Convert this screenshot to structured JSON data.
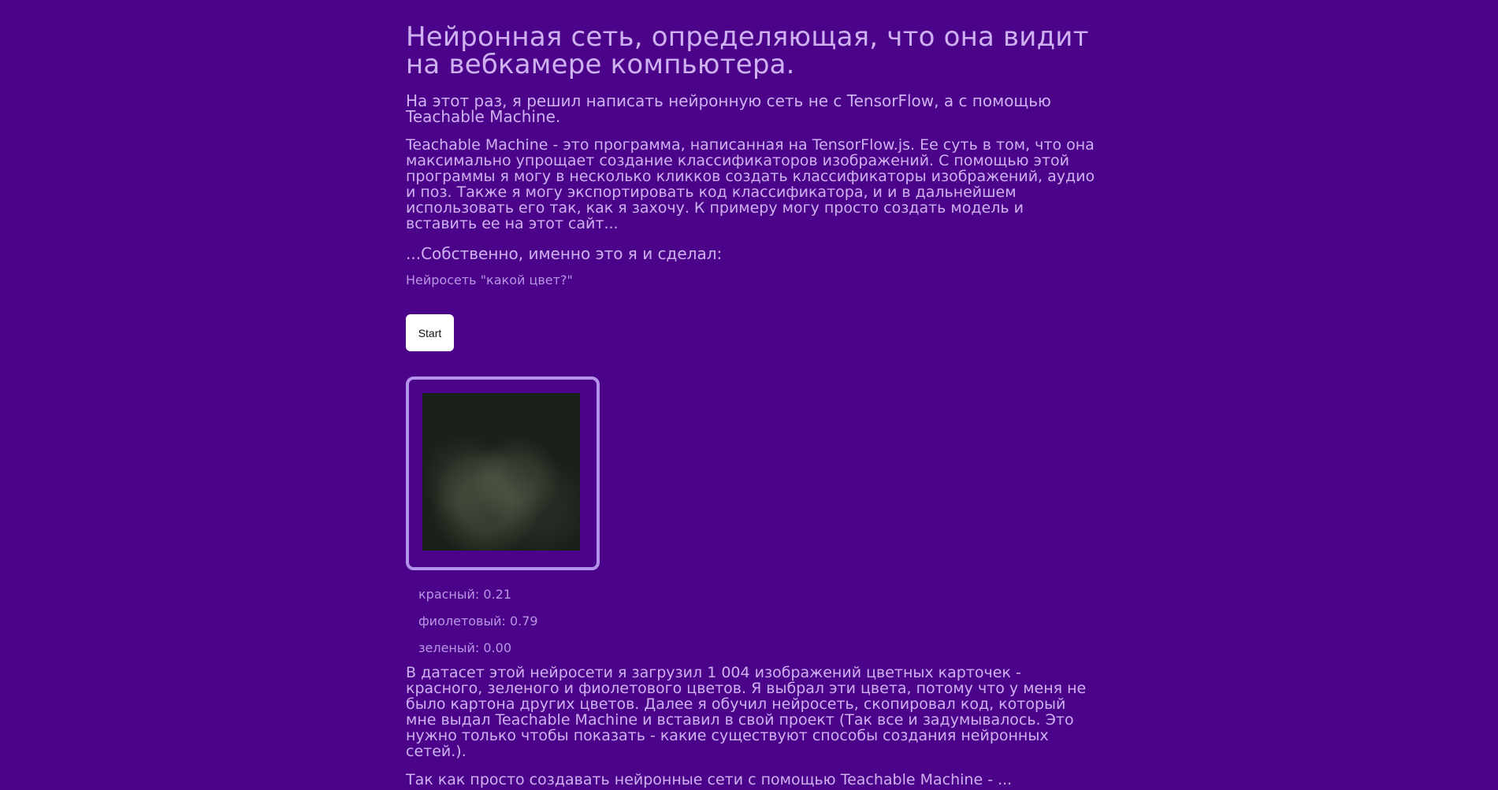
{
  "article": {
    "title": "Нейронная сеть, определяющая, что она видит на вебкамере компьютера.",
    "intro": "На этот раз, я решил написать нейронную сеть не с TensorFlow, а с помощью Teachable Machine.",
    "description": "Teachable Machine - это программа, написанная на TensorFlow.js. Ее суть в том, что она максимально упрощает создание классификаторов изображений. С помощью этой программы я могу в несколько кликков создать классификаторы изображений, аудио и поз. Также я могу экспортировать код классификатора, и и в дальнейшем использовать его так, как я захочу. К примеру могу просто создать модель и вставить ее на этот сайт...",
    "lead_in": "...Собственно, именно это я и сделал:",
    "dataset_text": "В датасет этой нейросети я загрузил 1 004 изображений цветных карточек - красного, зеленого и фиолетового цветов. Я выбрал эти цвета, потому что у меня не было картона других цветов. Далее я обучил нейросеть, скопировал код, который мне выдал Teachable Machine и вставил в свой проект (Так все и задумывалось. Это нужно только чтобы показать - какие существуют способы создания нейронных сетей.).",
    "closing_text": "Так как просто создавать нейронные сети с помощью Teachable Machine - ..."
  },
  "model": {
    "title": "Нейросеть \"какой цвет?\"",
    "start_label": "Start",
    "predictions": [
      {
        "label": "красный: 0.21"
      },
      {
        "label": "фиолетовый: 0.79"
      },
      {
        "label": "зеленый: 0.00"
      }
    ]
  },
  "colors": {
    "background": "#4b0389",
    "text": "#cfb1f2",
    "frame_border": "#b394ea"
  }
}
